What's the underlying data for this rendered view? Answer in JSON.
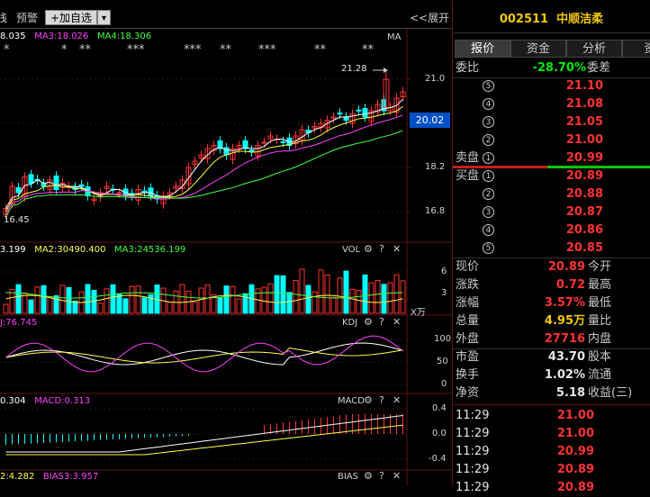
{
  "toolbar": {
    "left_cut": "栈",
    "alert": "预警",
    "add_watch": "+加自选",
    "dropdown": "▾",
    "expand": "<<展开"
  },
  "main_chart": {
    "ma_legend": [
      {
        "text": "8.035",
        "color": "#ffffff"
      },
      {
        "text": "MA3:18.026",
        "color": "#ff40ff"
      },
      {
        "text": "MA4:18.306",
        "color": "#40ff40"
      }
    ],
    "ma_tag": "MA",
    "markers": [
      {
        "text": "*"
      },
      {
        "text": "*"
      },
      {
        "text": "**"
      },
      {
        "text": "***"
      },
      {
        "text": "***"
      },
      {
        "text": "**"
      },
      {
        "text": "***"
      },
      {
        "text": "**"
      },
      {
        "text": "**"
      }
    ],
    "high_label": "21.28",
    "low_label": "16.45",
    "y_ticks": [
      "21.0",
      "18.2",
      "16.8"
    ],
    "current_price": "20.02"
  },
  "vol_panel": {
    "legend": [
      {
        "text": "3.199",
        "color": "#ffffff"
      },
      {
        "text": "MA2:30490.400",
        "color": "#ffff40"
      },
      {
        "text": "MA3:24536.199",
        "color": "#40ff40"
      }
    ],
    "tag": "VOL",
    "y_ticks": [
      "6",
      "3"
    ],
    "unit": "X万"
  },
  "kdj_panel": {
    "legend": [
      {
        "text": "J:76.745",
        "color": "#ff40ff"
      }
    ],
    "tag": "KDJ",
    "y_ticks": [
      "100",
      "50",
      "0"
    ]
  },
  "macd_panel": {
    "legend": [
      {
        "text": "0.304",
        "color": "#ffffff"
      },
      {
        "text": "MACD:0.313",
        "color": "#ff40ff"
      }
    ],
    "tag": "MACD",
    "y_ticks": [
      "0.4",
      "0.0",
      "-0.4"
    ]
  },
  "bias_panel": {
    "legend": [
      {
        "text": "2:4.282",
        "color": "#ffff40"
      },
      {
        "text": "BIAS3:3.957",
        "color": "#ff40ff"
      }
    ],
    "tag": "BIAS"
  },
  "right": {
    "stock_code": "002511",
    "stock_name": "中顺洁柔",
    "tabs": [
      "报价",
      "资金",
      "分析",
      "资"
    ],
    "ratio_label": "委比",
    "ratio_value": "-28.70%",
    "diff_label": "委差",
    "sell_label": "卖盘",
    "buy_label": "买盘",
    "sells": [
      {
        "n": "5",
        "price": "21.10"
      },
      {
        "n": "4",
        "price": "21.08"
      },
      {
        "n": "3",
        "price": "21.05"
      },
      {
        "n": "2",
        "price": "21.00"
      },
      {
        "n": "1",
        "price": "20.99"
      }
    ],
    "buys": [
      {
        "n": "1",
        "price": "20.89"
      },
      {
        "n": "2",
        "price": "20.88"
      },
      {
        "n": "3",
        "price": "20.87"
      },
      {
        "n": "4",
        "price": "20.86"
      },
      {
        "n": "5",
        "price": "20.85"
      }
    ],
    "quote": [
      {
        "l": "现价",
        "v": "20.89",
        "r": "今开",
        "color": "red"
      },
      {
        "l": "涨跌",
        "v": "0.72",
        "r": "最高",
        "color": "red"
      },
      {
        "l": "涨幅",
        "v": "3.57%",
        "r": "最低",
        "color": "red"
      },
      {
        "l": "总量",
        "v": "4.95万",
        "r": "量比",
        "color": "yellow"
      },
      {
        "l": "外盘",
        "v": "27716",
        "r": "内盘",
        "color": "red"
      },
      {
        "l": "市盈",
        "v": "43.70",
        "r": "股本",
        "color": "white"
      },
      {
        "l": "换手",
        "v": "1.02%",
        "r": "流通",
        "color": "white"
      },
      {
        "l": "净资",
        "v": "5.18",
        "r": "收益(三)",
        "color": "white"
      }
    ],
    "ticks": [
      {
        "t": "11:29",
        "p": "21.00"
      },
      {
        "t": "11:29",
        "p": "21.00"
      },
      {
        "t": "11:29",
        "p": "20.99"
      },
      {
        "t": "11:29",
        "p": "20.89"
      },
      {
        "t": "11:29",
        "p": "20.89"
      }
    ]
  },
  "colors": {
    "up": "#ff3232",
    "down": "#00ffff",
    "accent": "#f0c800",
    "price_box": "#0050c8"
  }
}
